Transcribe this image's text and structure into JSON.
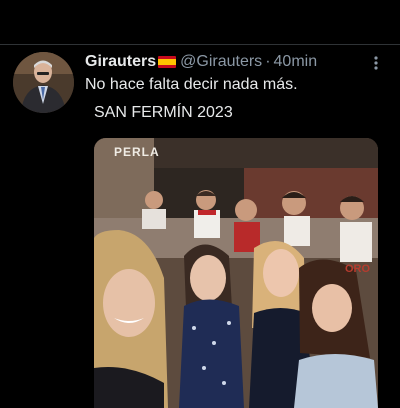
{
  "tweet": {
    "display_name": "Girauters",
    "handle": "@Girauters",
    "separator": "·",
    "time": "40min",
    "more_icon": "more-vertical-icon",
    "text_line1": "No hace falta decir nada más.",
    "text_line2": "SAN FERMÍN 2023",
    "flag_icon": "spain-flag-icon"
  },
  "media": {
    "sign_text": "PERLA",
    "shirt_text": "ORO"
  }
}
